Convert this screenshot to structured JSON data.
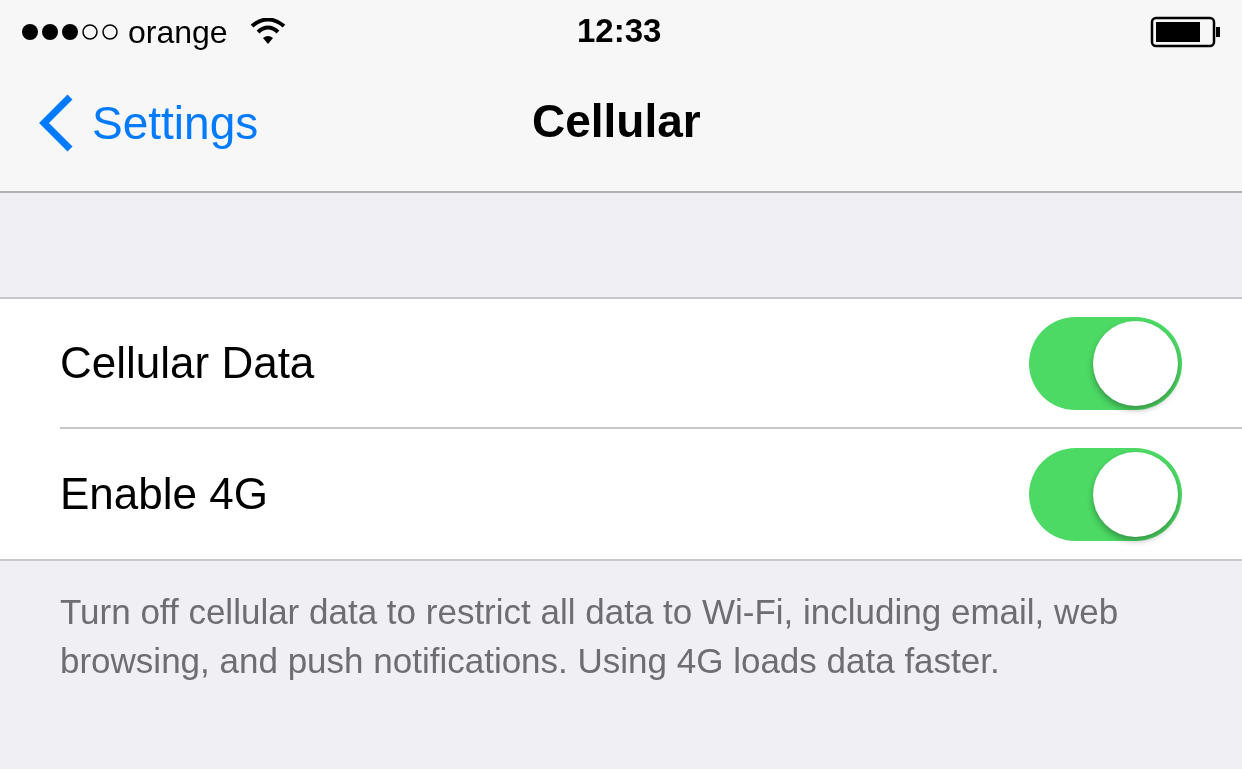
{
  "status_bar": {
    "carrier": "orange",
    "time": "12:33"
  },
  "nav_bar": {
    "back": "Settings",
    "title": "Cellular"
  },
  "settings": [
    {
      "label": "Cellular Data",
      "on": true
    },
    {
      "label": "Enable 4G",
      "on": true
    }
  ],
  "footer": "Turn off cellular data to restrict all data to Wi-Fi, including email, web browsing, and push notifications. Using 4G loads data faster."
}
